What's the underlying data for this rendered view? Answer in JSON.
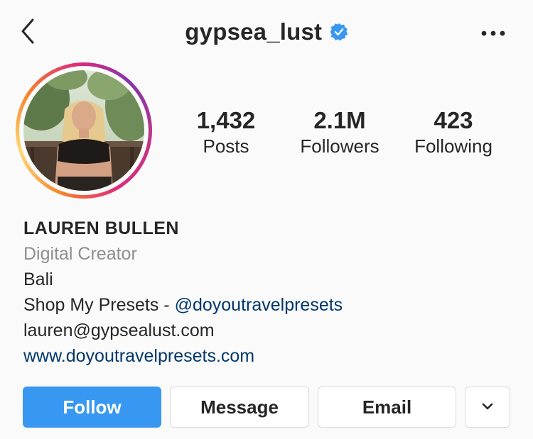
{
  "header": {
    "username": "gypsea_lust",
    "back_icon": "chevron-left-icon",
    "verified_icon": "verified-badge-icon",
    "more_icon": "more-horizontal-icon"
  },
  "stats": [
    {
      "value": "1,432",
      "label": "Posts"
    },
    {
      "value": "2.1M",
      "label": "Followers"
    },
    {
      "value": "423",
      "label": "Following"
    }
  ],
  "bio": {
    "name": "LAUREN BULLEN",
    "category": "Digital Creator",
    "location": "Bali",
    "shop_prefix": "Shop My Presets - ",
    "shop_handle": "@doyoutravelpresets",
    "email": "lauren@gypsealust.com",
    "website": "www.doyoutravelpresets.com"
  },
  "actions": {
    "follow": "Follow",
    "message": "Message",
    "email": "Email",
    "dropdown_icon": "chevron-down-icon"
  },
  "colors": {
    "follow_blue": "#3897f0",
    "verified_blue": "#3897f0",
    "link": "#00376b",
    "secondary_text": "#8e8e8e"
  }
}
